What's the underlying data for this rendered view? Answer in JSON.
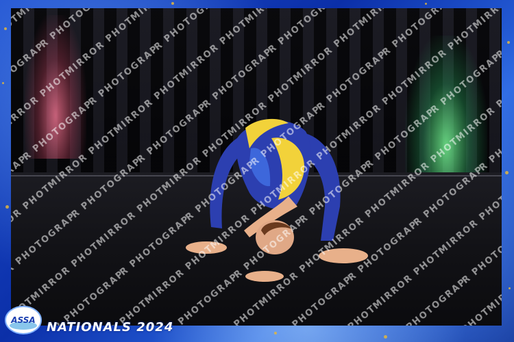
{
  "event": {
    "logo_text": "ASSA",
    "title": "NATIONALS 2024"
  },
  "watermark": {
    "text": "MIRROR PHOTOGRAPHY",
    "color": "#ffffff"
  },
  "colors": {
    "frame_blue": "#0b2fa8",
    "gold_accent": "#e0b640",
    "costume_blue": "#2c3fb0",
    "costume_yellow": "#f2d23a"
  }
}
